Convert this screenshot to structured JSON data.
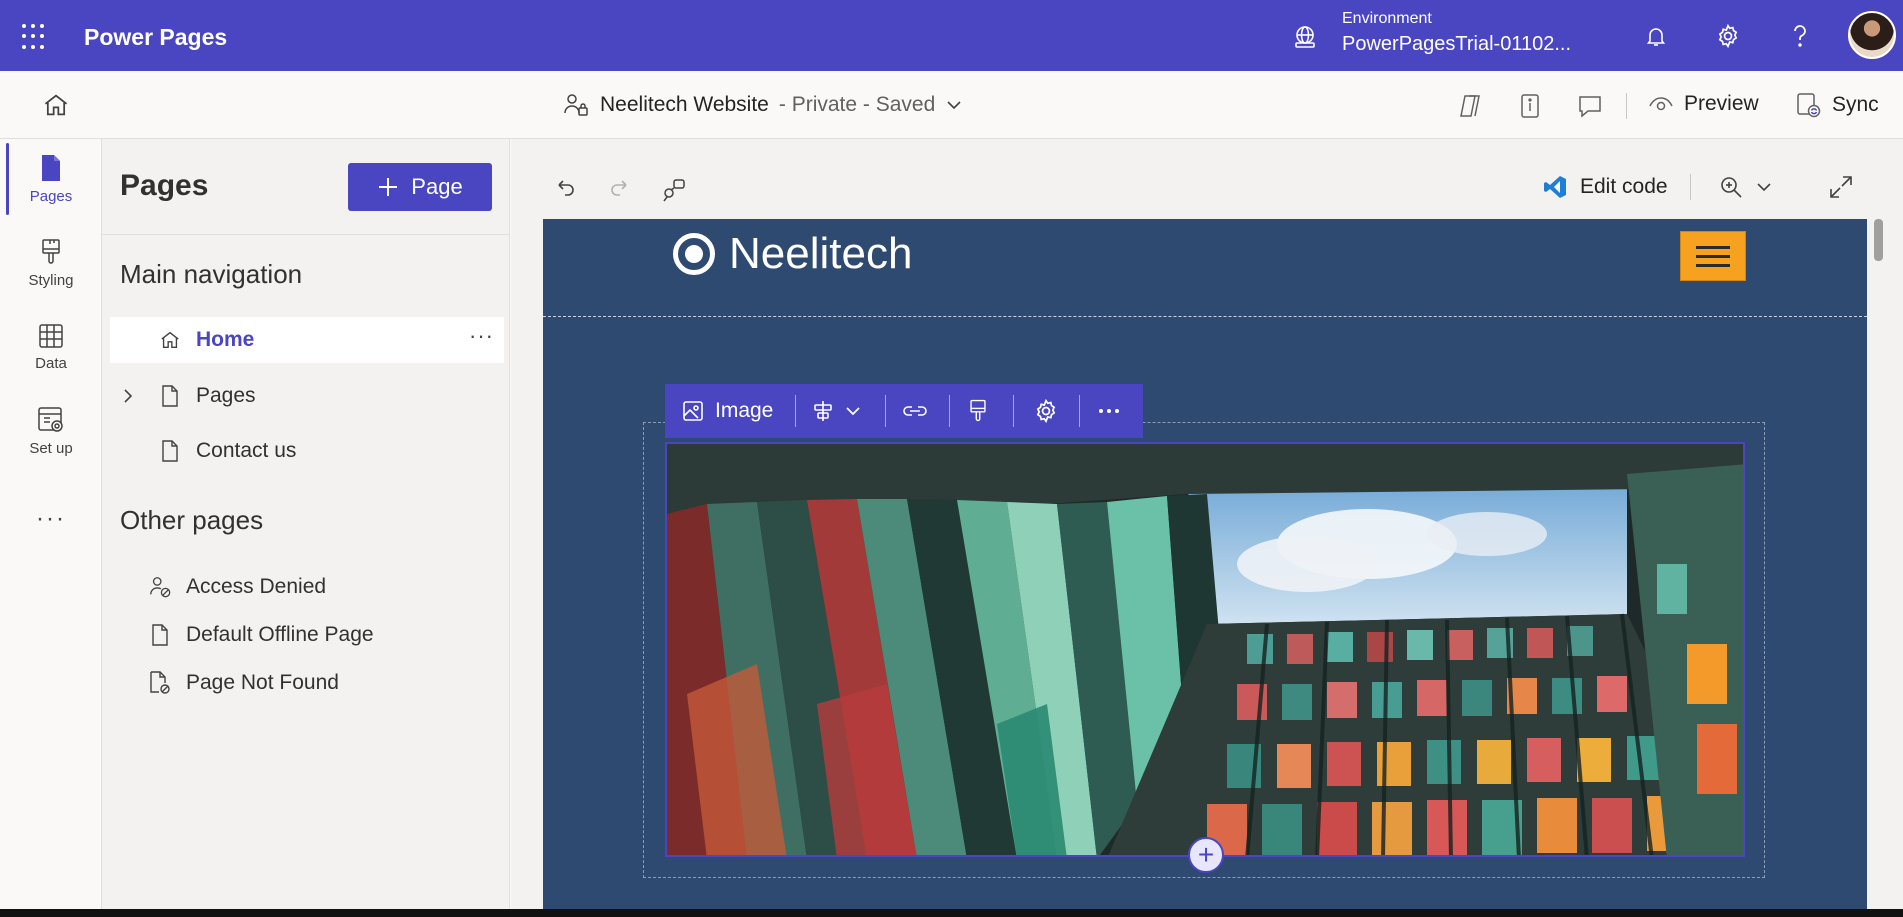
{
  "topbar": {
    "app_title": "Power Pages",
    "environment_label": "Environment",
    "environment_value": "PowerPagesTrial-01102...",
    "bg": "#4a45c0"
  },
  "secondbar": {
    "site_name": "Neelitech Website",
    "site_status": "- Private - Saved",
    "preview_label": "Preview",
    "sync_label": "Sync"
  },
  "rail": {
    "items": [
      {
        "label": "Pages",
        "icon": "page-icon"
      },
      {
        "label": "Styling",
        "icon": "paintbrush-icon"
      },
      {
        "label": "Data",
        "icon": "table-icon"
      },
      {
        "label": "Set up",
        "icon": "settings-grid-icon"
      }
    ],
    "more": "···"
  },
  "panel": {
    "title": "Pages",
    "add_button": "Page",
    "main_nav_title": "Main navigation",
    "main_nav": [
      {
        "label": "Home",
        "icon": "home-icon"
      },
      {
        "label": "Pages",
        "icon": "page-icon"
      },
      {
        "label": "Contact us",
        "icon": "page-icon"
      }
    ],
    "other_title": "Other pages",
    "other_pages": [
      {
        "label": "Access Denied",
        "icon": "person-lock-icon"
      },
      {
        "label": "Default Offline Page",
        "icon": "page-icon"
      },
      {
        "label": "Page Not Found",
        "icon": "page-search-icon"
      }
    ],
    "more": "···"
  },
  "canvas": {
    "edit_code": "Edit code"
  },
  "site": {
    "logo_text": "Neelitech",
    "image_toolbar_label": "Image",
    "accent": "#f6a21e",
    "bg": "#2f4a70"
  }
}
